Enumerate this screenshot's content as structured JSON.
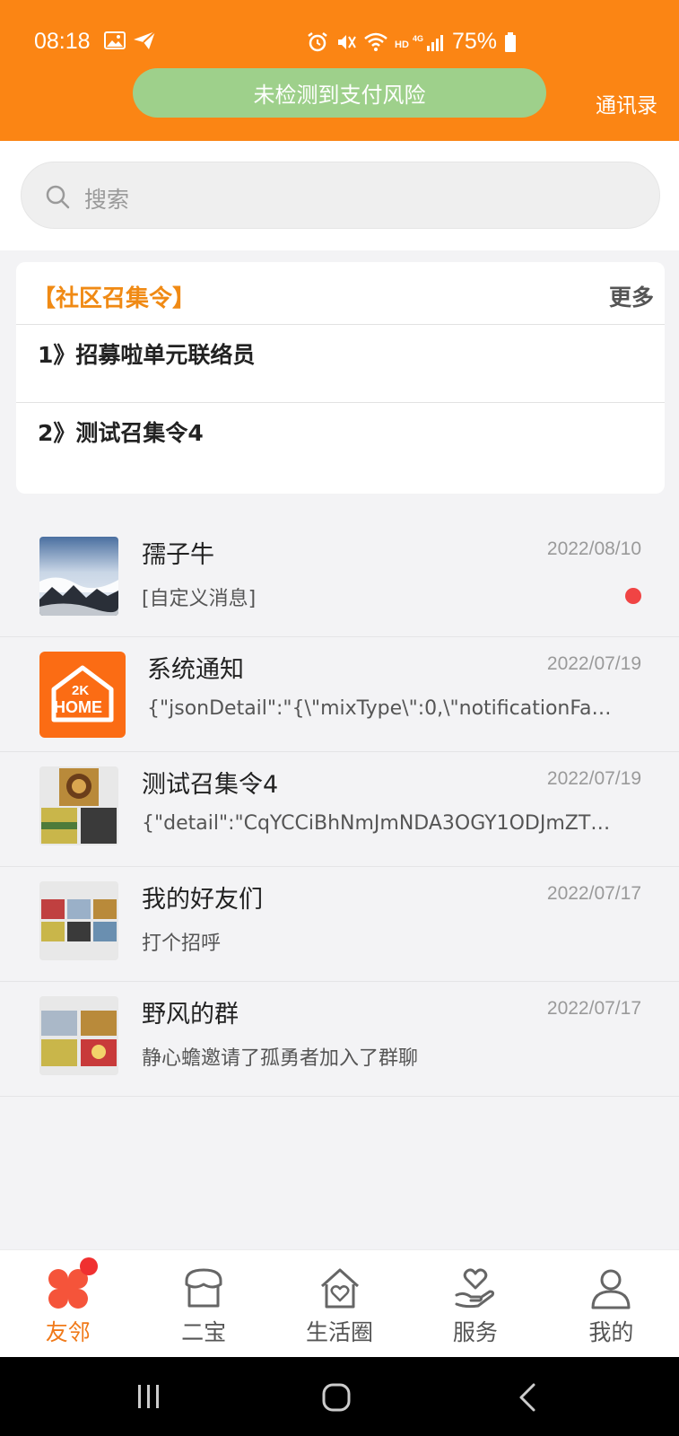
{
  "status_bar": {
    "time": "08:18",
    "battery": "75%",
    "network": "HD 4G"
  },
  "header": {
    "risk_text": "未检测到支付风险",
    "contacts_label": "通讯录"
  },
  "search": {
    "placeholder": "搜索"
  },
  "announcement": {
    "title": "【社区召集令】",
    "more_label": "更多",
    "items": [
      {
        "label": "1》招募啦单元联络员"
      },
      {
        "label": "2》测试召集令4"
      }
    ]
  },
  "chats": [
    {
      "name": "孺子牛",
      "time": "2022/08/10",
      "preview": "[自定义消息]",
      "unread": true
    },
    {
      "name": "系统通知",
      "time": "2022/07/19",
      "preview": "{\"jsonDetail\":\"{\\\"mixType\\\":0,\\\"notificationFa…",
      "avatar_text_1": "2K",
      "avatar_text_2": "HOME"
    },
    {
      "name": "测试召集令4",
      "time": "2022/07/19",
      "preview": "{\"detail\":\"CqYCCiBhNmJmNDA3OGY1ODJmZT…"
    },
    {
      "name": "我的好友们",
      "time": "2022/07/17",
      "preview": "打个招呼"
    },
    {
      "name": "野风的群",
      "time": "2022/07/17",
      "preview": "静心蟾邀请了孤勇者加入了群聊"
    }
  ],
  "tabs": [
    {
      "label": "友邻",
      "active": true,
      "icon": "clover-icon",
      "badge": true
    },
    {
      "label": "二宝",
      "icon": "shop-icon"
    },
    {
      "label": "生活圈",
      "icon": "home-heart-icon"
    },
    {
      "label": "服务",
      "icon": "hand-heart-icon"
    },
    {
      "label": "我的",
      "icon": "person-icon"
    }
  ],
  "colors": {
    "brand_orange": "#fb8514",
    "risk_green": "#9ed08b",
    "title_orange": "#f08a14",
    "active_tab": "#f07a1a",
    "unread_red": "#f04444"
  }
}
